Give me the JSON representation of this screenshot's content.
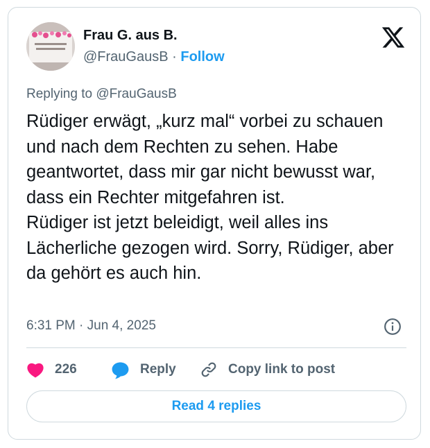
{
  "author": {
    "display_name": "Frau G. aus B.",
    "handle": "@FrauGausB",
    "separator": "·",
    "follow_label": "Follow"
  },
  "logo": {
    "icon": "x-logo-icon"
  },
  "reply_context": "Replying to @FrauGausB",
  "tweet": {
    "paragraph1": "Rüdiger erwägt, „kurz mal“ vorbei zu schauen und nach dem Rechten zu sehen. Habe geantwortet, dass mir gar nicht bewusst war, dass ein Rechter mitgefahren ist.",
    "paragraph2": "Rüdiger ist jetzt beleidigt, weil alles ins Lächerliche gezogen wird. Sorry, Rüdiger, aber da gehört es auch hin."
  },
  "timestamp": "6:31 PM · Jun 4, 2025",
  "actions": {
    "like_count": "226",
    "reply_label": "Reply",
    "copy_label": "Copy link to post"
  },
  "read_replies_label": "Read 4 replies",
  "colors": {
    "accent": "#1d9bf0",
    "like": "#f91880",
    "text": "#0f1419",
    "muted": "#536471",
    "border": "#cfd9de"
  }
}
